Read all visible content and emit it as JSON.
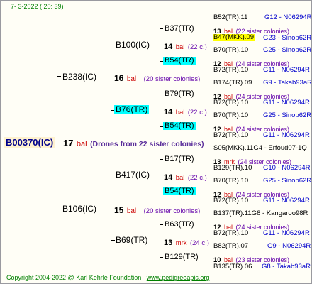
{
  "header": {
    "date": "7-  3-2022  ( 20:  39)"
  },
  "root": {
    "name": "B00370(IC)",
    "num": "17",
    "word": "bal",
    "note": "(Drones from 22 sister colonies)"
  },
  "parents": [
    {
      "name": "B238(IC)",
      "num": "16",
      "word": "bal",
      "note": "(20 sister colonies)"
    },
    {
      "name": "B106(IC)",
      "num": "15",
      "word": "bal",
      "note": "(20 sister colonies)"
    }
  ],
  "gp": [
    {
      "name": "B100(IC)",
      "num": "14",
      "word": "bal",
      "note": "(22 c.)"
    },
    {
      "name": "B76(TR)",
      "num": "14",
      "word": "bal",
      "note": "(22 c.)"
    },
    {
      "name": "B417(IC)",
      "num": "14",
      "word": "bal",
      "note": "(22 c.)"
    },
    {
      "name": "B69(TR)",
      "num": "13",
      "word": "mrk",
      "note": "(24 c.)"
    }
  ],
  "ggp": [
    {
      "name": "B37(TR)",
      "num": "13",
      "word": "bal",
      "note": "(22 sister colonies)"
    },
    {
      "name": "B54(TR)",
      "num": "12",
      "word": "bal",
      "note": "(24 sister colonies)"
    },
    {
      "name": "B79(TR)",
      "num": "12",
      "word": "bal",
      "note": "(24 sister colonies)"
    },
    {
      "name": "B54(TR)",
      "num": "12",
      "word": "bal",
      "note": "(24 sister colonies)"
    },
    {
      "name": "B17(TR)",
      "num": "13",
      "word": "mrk",
      "note": "(24 sister colonies)"
    },
    {
      "name": "B54(TR)",
      "num": "12",
      "word": "bal",
      "note": "(24 sister colonies)"
    },
    {
      "name": "B63(TR)",
      "num": "12",
      "word": "bal",
      "note": "(24 sister colonies)"
    },
    {
      "name": "B129(TR)",
      "num": "10",
      "word": "bal",
      "note": "(23 sister colonies)"
    }
  ],
  "g4": [
    {
      "left": "B52(TR).11",
      "right": "G12 - N06294R"
    },
    {
      "left": "B47(MKK).09",
      "right": "G23 - Sinop62R"
    },
    {
      "left": "B70(TR).10",
      "right": "G25 - Sinop62R"
    },
    {
      "left": "B72(TR).10",
      "right": "G11 - N06294R"
    },
    {
      "left": "B174(TR).09",
      "right": "G9 - Takab93aR"
    },
    {
      "left": "B72(TR).10",
      "right": "G11 - N06294R"
    },
    {
      "left": "B70(TR).10",
      "right": "G25 - Sinop62R"
    },
    {
      "left": "B72(TR).10",
      "right": "G11 - N06294R"
    },
    {
      "left": "S05(MKK).11G4 - Erfoud07-1Q",
      "right": ""
    },
    {
      "left": "B129(TR).10",
      "right": "G10 - N06294R"
    },
    {
      "left": "B70(TR).10",
      "right": "G25 - Sinop62R"
    },
    {
      "left": "B72(TR).10",
      "right": "G11 - N06294R"
    },
    {
      "left": "B137(TR).11G8 - Kangaroo98R",
      "right": ""
    },
    {
      "left": "B72(TR).10",
      "right": "G11 - N06294R"
    },
    {
      "left": "B82(TR).07",
      "right": "G9 - N06294R"
    },
    {
      "left": "B135(TR).06",
      "right": "G8 - Takab93aR"
    }
  ],
  "footer": {
    "copyright": "Copyright 2004-2022 @ Karl Kehrle Foundation",
    "site": "www.pedigreeapis.org"
  }
}
